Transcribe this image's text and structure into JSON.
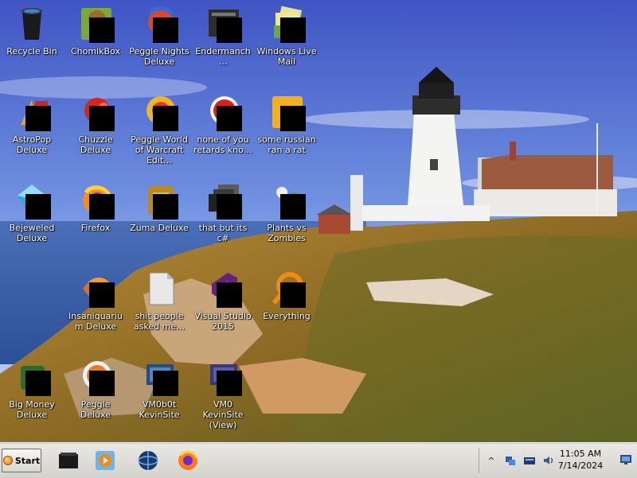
{
  "desktop": {
    "icons": [
      {
        "label": "Recycle Bin",
        "icon": "recycle-bin-icon"
      },
      {
        "label": "ChomikBox",
        "icon": "chomikbox-icon"
      },
      {
        "label": "Peggle Nights Deluxe",
        "icon": "peggle-nights-icon"
      },
      {
        "label": "Endermanch…",
        "icon": "folder-shortcut-icon"
      },
      {
        "label": "Windows Live Mail",
        "icon": "windows-live-mail-icon"
      },
      {
        "label": "AstroPop Deluxe",
        "icon": "astropop-icon"
      },
      {
        "label": "Chuzzle Deluxe",
        "icon": "chuzzle-icon"
      },
      {
        "label": "Peggle World of Warcraft Edit…",
        "icon": "peggle-wow-icon"
      },
      {
        "label": "none of you retards kno…",
        "icon": "red-orb-icon"
      },
      {
        "label": "some russian ran a rat",
        "icon": "yellow-document-icon"
      },
      {
        "label": "Bejeweled Deluxe",
        "icon": "bejeweled-icon"
      },
      {
        "label": "Firefox",
        "icon": "firefox-icon"
      },
      {
        "label": "Zuma Deluxe",
        "icon": "zuma-icon"
      },
      {
        "label": "that but its c#",
        "icon": "window-stack-icon"
      },
      {
        "label": "Plants vs Zombies",
        "icon": "plants-vs-zombies-icon"
      },
      {
        "label": "Insaniquarium Deluxe",
        "icon": "insaniquarium-icon"
      },
      {
        "label": "shit people asked me…",
        "icon": "file-icon"
      },
      {
        "label": "Visual Studio 2015",
        "icon": "visual-studio-icon"
      },
      {
        "label": "Everything",
        "icon": "everything-search-icon"
      },
      {
        "label": "Big Money Deluxe",
        "icon": "big-money-icon"
      },
      {
        "label": "Peggle Deluxe",
        "icon": "peggle-icon"
      },
      {
        "label": "VM0b0t KevinSite",
        "icon": "vm-icon"
      },
      {
        "label": "VM0 KevinSite (View)",
        "icon": "vm-view-icon"
      }
    ]
  },
  "taskbar": {
    "start_label": "Start",
    "pinned": [
      {
        "icon": "terminal-icon"
      },
      {
        "icon": "media-player-icon"
      },
      {
        "icon": "globe-icon"
      },
      {
        "icon": "firefox-icon"
      }
    ],
    "tray": {
      "chevron": "^",
      "icons": [
        "network-icon",
        "keyboard-icon",
        "volume-icon"
      ]
    },
    "clock": {
      "time": "11:05 AM",
      "date": "7/14/2024"
    }
  },
  "colors": {
    "sky_top": "#4b63c9",
    "sea": "#3b5fa8",
    "taskbar": "#dcdad5"
  }
}
